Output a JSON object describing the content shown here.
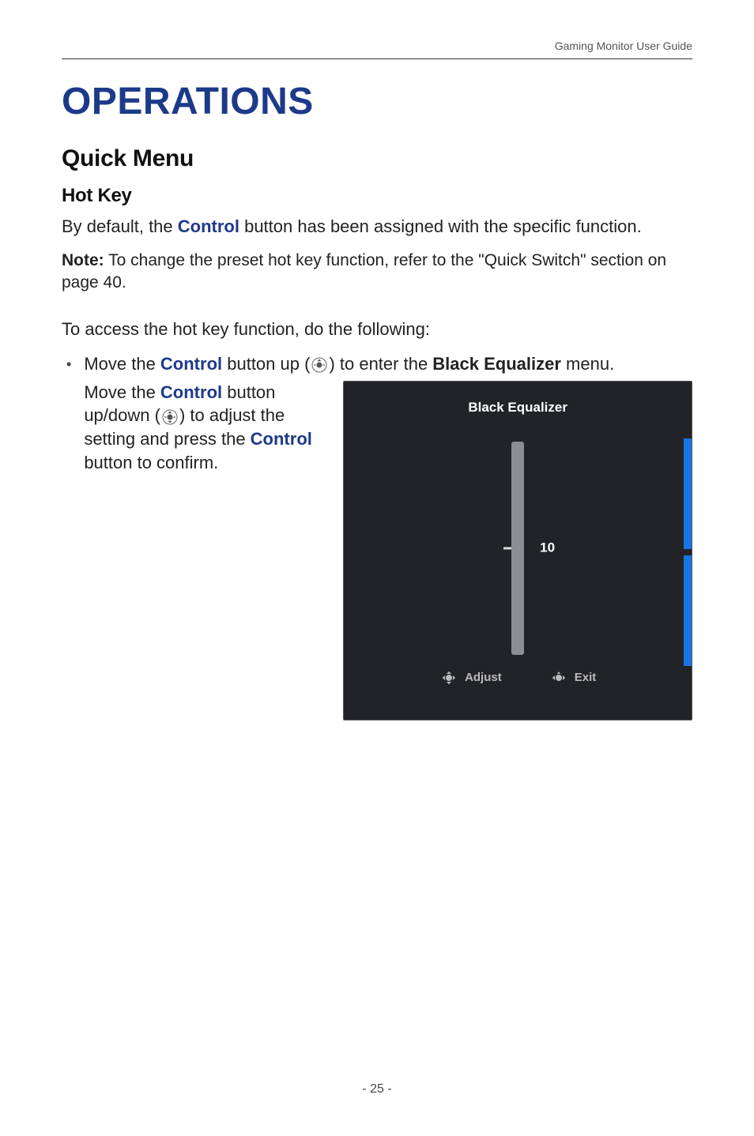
{
  "header": {
    "running": "Gaming Monitor User Guide"
  },
  "title": "OPERATIONS",
  "section": "Quick Menu",
  "subsection": "Hot Key",
  "para1_a": "By default, the ",
  "para1_kw": "Control",
  "para1_b": " button has been assigned with the specific function.",
  "note_label": "Note:",
  "note_body": " To change the preset hot key function, refer to the \"Quick Switch\" section on page 40.",
  "para2": "To access the hot key function, do the following:",
  "bullet1_a": "Move the ",
  "bullet1_kw1": "Control",
  "bullet1_b": " button up (",
  "bullet1_c": ") to enter the ",
  "bullet1_bold": "Black Equalizer",
  "bullet1_d": " menu.",
  "left_a": "Move the ",
  "left_kw1": "Control",
  "left_b": " button up/down (",
  "left_c": ") to adjust the setting and press the ",
  "left_kw2": "Control",
  "left_d": " button to confirm.",
  "osd": {
    "title": "Black Equalizer",
    "value": "10",
    "adjust": "Adjust",
    "exit": "Exit"
  },
  "page_number": "- 25 -"
}
